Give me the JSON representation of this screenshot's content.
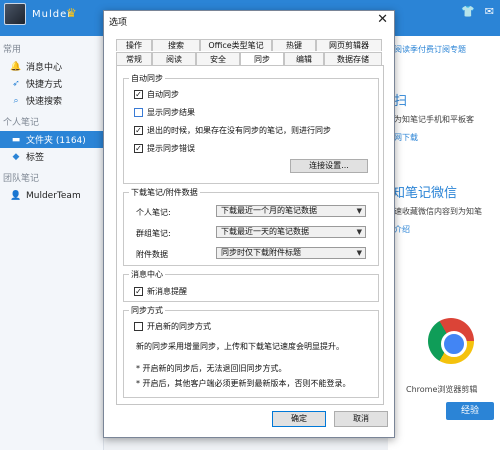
{
  "app": {
    "user": "Mulder",
    "sidebar": {
      "section_common": "常用",
      "items_common": [
        "消息中心",
        "快捷方式",
        "快速搜索"
      ],
      "section_personal": "个人笔记",
      "folder": "文件夹 (1164)",
      "tags": "标签",
      "section_team": "团队笔记",
      "team": "MulderTeam"
    },
    "main": {
      "link_top": "阅读季付费订阅专题",
      "scan_head": "扫",
      "scan_text": "为知笔记手机和平板客",
      "download_link": "网下载",
      "wechat_head": "知笔记微信",
      "wechat_text": "速收藏微信内容到为知笔",
      "intro_link": "介绍",
      "chrome_label": "Chrome浏览器剪辑",
      "chrome_button": "经验"
    }
  },
  "dialog": {
    "title": "选项",
    "close": "✕",
    "tabs_row1": [
      "操作",
      "搜索",
      "Office类型笔记",
      "热键",
      "网页剪辑器"
    ],
    "tabs_row2": [
      "常规",
      "阅读",
      "安全",
      "同步",
      "编辑",
      "数据存储"
    ],
    "active_tab": "同步",
    "auto_sync": {
      "title": "自动同步",
      "options": [
        {
          "label": "自动同步",
          "checked": true
        },
        {
          "label": "显示同步结果",
          "checked": false
        },
        {
          "label": "退出的时候，如果存在没有同步的笔记，则进行同步",
          "checked": true
        },
        {
          "label": "提示同步错误",
          "checked": true
        }
      ],
      "connect_button": "连接设置..."
    },
    "download": {
      "title": "下载笔记/附件数据",
      "personal_label": "个人笔记:",
      "personal_value": "下载最近一个月的笔记数据",
      "group_label": "群组笔记:",
      "group_value": "下载最近一天的笔记数据",
      "attach_label": "附件数据",
      "attach_value": "同步时仅下载附件标题"
    },
    "message": {
      "title": "消息中心",
      "option": {
        "label": "新消息提醒",
        "checked": true
      }
    },
    "sync_mode": {
      "title": "同步方式",
      "option": {
        "label": "开启新的同步方式",
        "checked": false
      },
      "desc": "新的同步采用增量同步，上传和下载笔记速度会明显提升。",
      "note1": "* 开启新的同步后，无法退回旧同步方式。",
      "note2": "* 开启后，其他客户端必须更新到最新版本，否则不能登录。"
    },
    "ok_button": "确定",
    "cancel_button": "取消"
  },
  "colors": {
    "accent": "#2b84d6",
    "dialog_border": "#7a8597"
  }
}
